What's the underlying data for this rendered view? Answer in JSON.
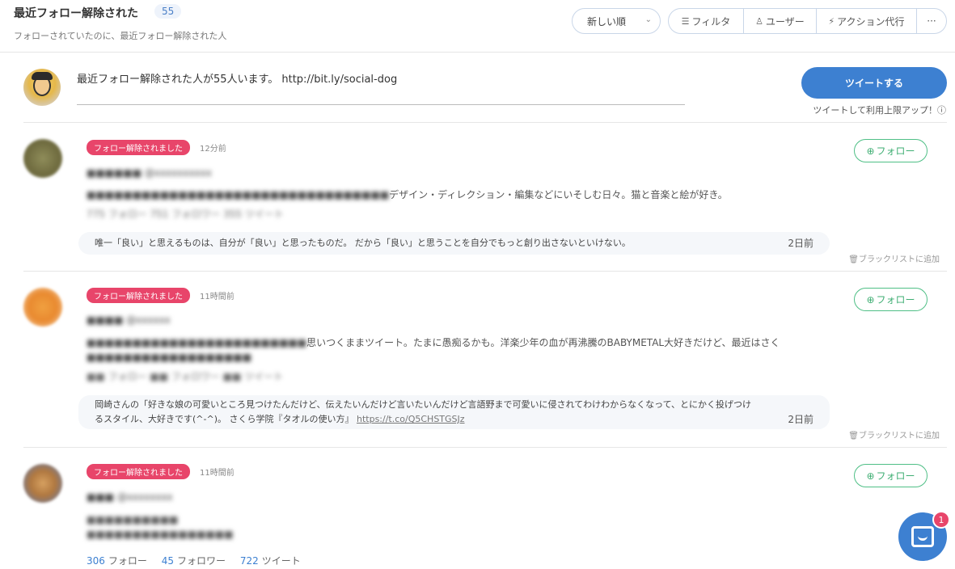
{
  "header": {
    "title": "最近フォロー解除された",
    "count": "55",
    "subtitle": "フォローされていたのに、最近フォロー解除された人",
    "sort_label": "新しい順",
    "filter_label": "フィルタ",
    "user_label": "ユーザー",
    "action_label": "アクション代行",
    "more_label": "···"
  },
  "compose": {
    "text": "最近フォロー解除された人が55人います。 http://bit.ly/social-dog",
    "tweet_button": "ツイートする",
    "tweet_note": "ツイートして利用上限アップ！ⓘ"
  },
  "items": [
    {
      "badge": "フォロー解除されました",
      "time": "12分前",
      "follow_label": "フォロー",
      "name_blur": "■■■■■■ @xxxxxxxxxx",
      "bio_visible": "デザイン・ディレクション・編集などにいそしむ日々。猫と音楽と絵が好き。",
      "stats_blur": "775 フォロー 751 フォロワー 355 ツイート",
      "tweet_text": "唯一「良い」と思えるものは、自分が「良い」と思ったものだ。 だから「良い」と思うことを自分でもっと創り出さないといけない。",
      "tweet_date": "2日前",
      "blacklist": "ブラックリストに追加"
    },
    {
      "badge": "フォロー解除されました",
      "time": "11時間前",
      "follow_label": "フォロー",
      "name_blur": "■■■■ @xxxxxx",
      "bio_visible": "思いつくままツイート。たまに愚痴るかも。洋楽少年の血が再沸騰のBABYMETAL大好きだけど、最近はさく",
      "stats_blur": "■■ フォロー ■■ フォロワー ■■ ツイート",
      "tweet_text": "岡崎さんの「好きな娘の可愛いところ見つけたんだけど、伝えたいんだけど言いたいんだけど言語野まで可愛いに侵されてわけわからなくなって、とにかく投げつけるスタイル、大好きです(^-^)。 さくら学院『タオルの使い方』",
      "tweet_link": "https://t.co/Q5CHSTGSJz",
      "tweet_date": "2日前",
      "blacklist": "ブラックリストに追加"
    },
    {
      "badge": "フォロー解除されました",
      "time": "11時間前",
      "follow_label": "フォロー",
      "name_blur": "■■■ @xxxxxxxx",
      "stats": {
        "following": "306",
        "following_label": "フォロー",
        "followers": "45",
        "followers_label": "フォロワー",
        "tweets": "722",
        "tweets_label": "ツイート"
      }
    }
  ],
  "chat": {
    "unread": "1"
  },
  "colors": {
    "accent": "#3d80d1",
    "badge": "#e8456a",
    "follow": "#3fae73"
  }
}
